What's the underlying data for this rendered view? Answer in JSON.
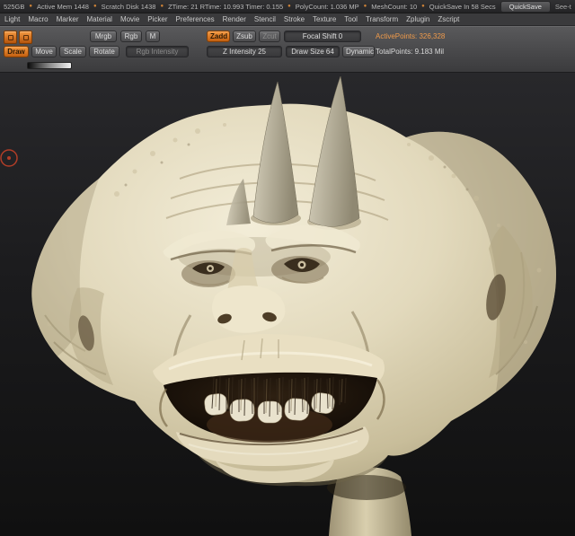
{
  "statusbar": {
    "dot": "●",
    "segments": [
      "525GB",
      "Active Mem 1448",
      "Scratch Disk 1438",
      "ZTime: 21  RTime: 10.993  Timer: 0.155",
      "PolyCount: 1.036 MP",
      "MeshCount: 10",
      "QuickSave In 58 Secs"
    ],
    "quicksave": "QuickSave",
    "see_through": "See-th"
  },
  "menubar": {
    "items": [
      "Light",
      "Macro",
      "Marker",
      "Material",
      "Movie",
      "Picker",
      "Preferences",
      "Render",
      "Stencil",
      "Stroke",
      "Texture",
      "Tool",
      "Transform",
      "Zplugin",
      "Zscript"
    ]
  },
  "toolbar": {
    "draw": "Draw",
    "move": "Move",
    "scale": "Scale",
    "rotate": "Rotate",
    "mrgb": "Mrgb",
    "rgb": "Rgb",
    "m": "M",
    "rgb_intensity": "Rgb Intensity",
    "zadd": "Zadd",
    "zsub": "Zsub",
    "zcut": "Zcut",
    "focal_shift": "Focal Shift 0",
    "z_intensity": "Z Intensity 25",
    "draw_size": "Draw Size 64",
    "dynamic": "Dynamic",
    "active_points": "ActivePoints: 326,328",
    "total_points": "TotalPoints: 9.183 Mil"
  },
  "canvas": {
    "model_name": "ogre-head-sculpt"
  },
  "colors": {
    "accent_orange": "#e0752c",
    "skin": "#ddd3b4",
    "canvas_bg": "#1a1a1c"
  }
}
